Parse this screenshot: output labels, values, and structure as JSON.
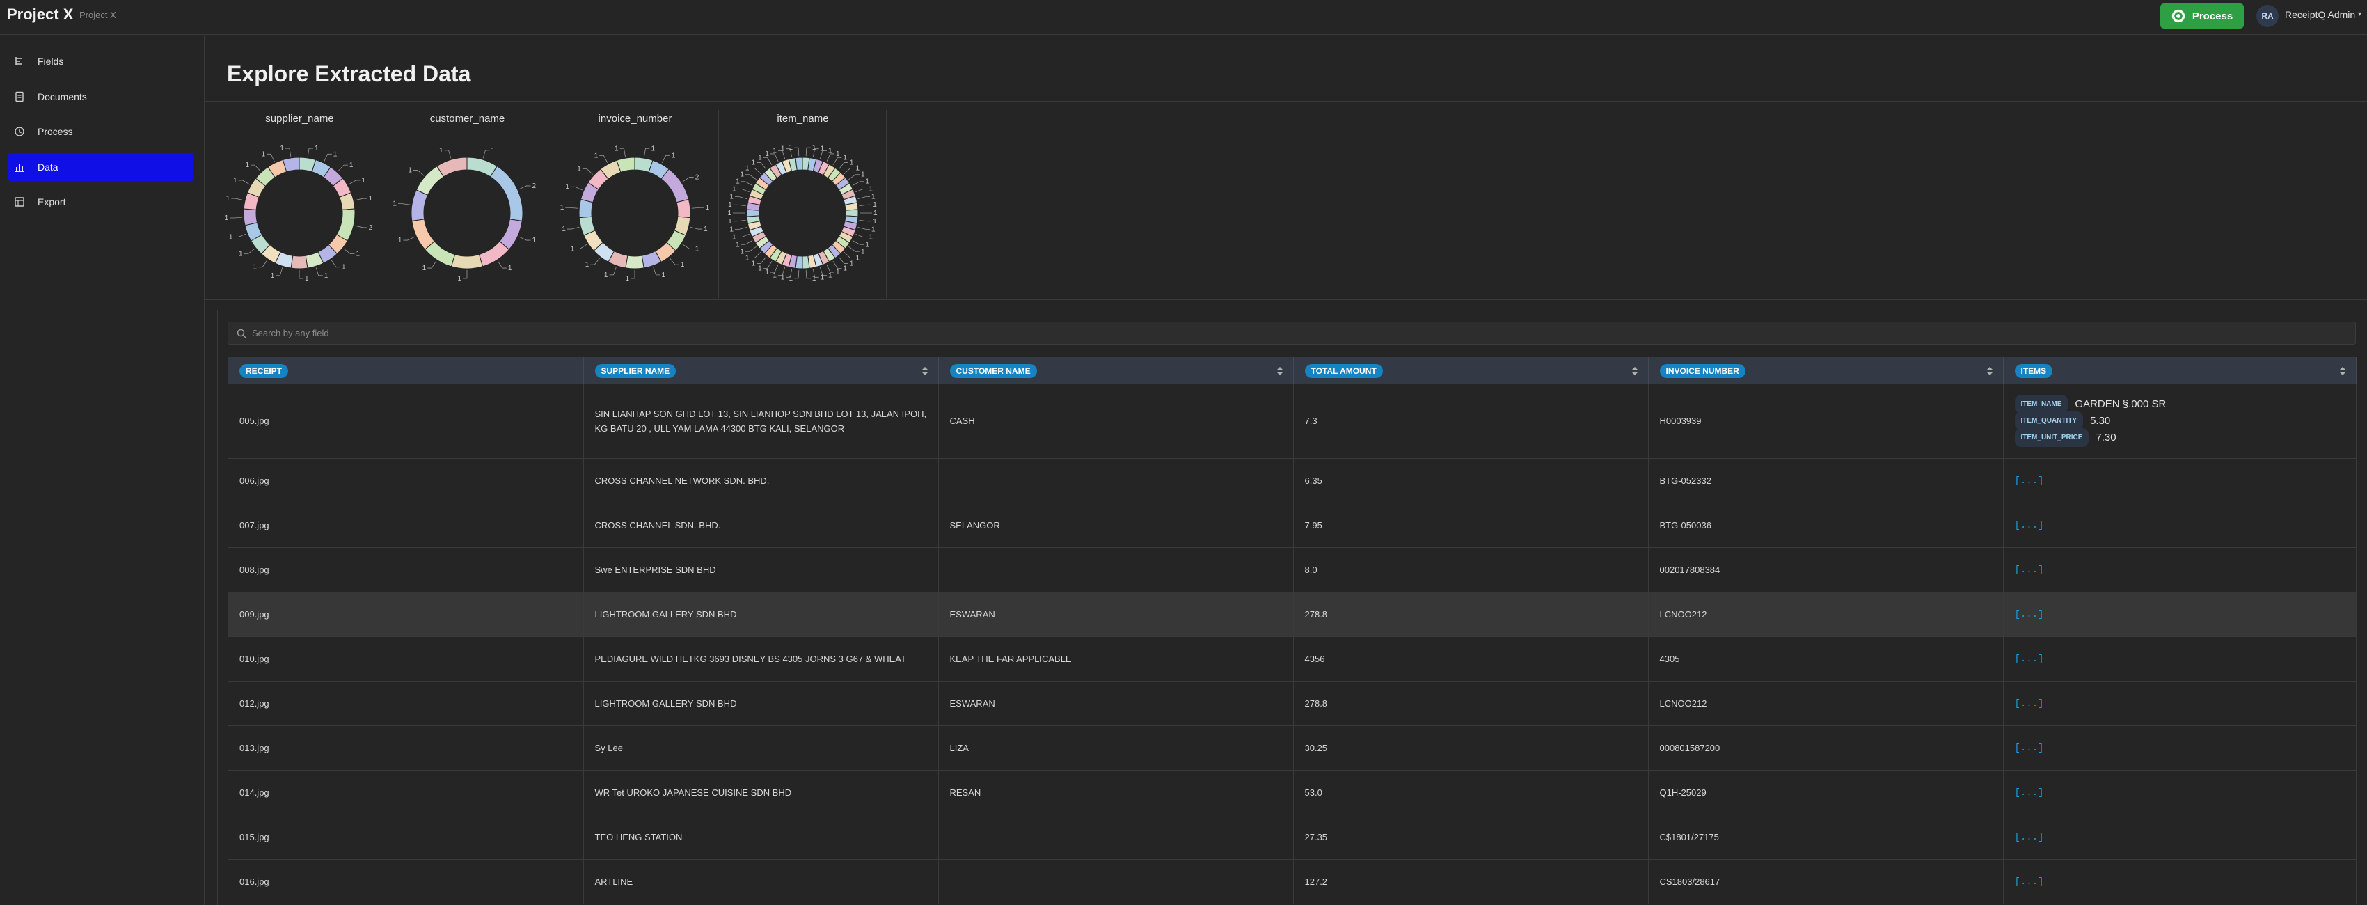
{
  "header": {
    "app_title": "Project X",
    "project_name": "Project X",
    "process_label": "Process",
    "user_initials": "RA",
    "user_name": "ReceiptQ Admin"
  },
  "sidebar": {
    "items": [
      {
        "label": "Fields",
        "icon": "fields-icon",
        "active": false
      },
      {
        "label": "Documents",
        "icon": "document-icon",
        "active": false
      },
      {
        "label": "Process",
        "icon": "process-icon",
        "active": false
      },
      {
        "label": "Data",
        "icon": "bar-chart-icon",
        "active": true
      },
      {
        "label": "Export",
        "icon": "export-icon",
        "active": false
      }
    ]
  },
  "page": {
    "title": "Explore Extracted Data"
  },
  "charts": [
    {
      "title": "supplier_name",
      "segment_values": [
        1,
        1,
        1,
        1,
        1,
        2,
        1,
        1,
        1,
        1,
        1,
        1,
        1,
        1,
        1,
        1,
        1,
        1,
        1,
        1
      ]
    },
    {
      "title": "customer_name",
      "segment_values": [
        1,
        2,
        1,
        1,
        1,
        1,
        1,
        1,
        1,
        1
      ]
    },
    {
      "title": "invoice_number",
      "segment_values": [
        1,
        1,
        2,
        1,
        1,
        1,
        1,
        1,
        1,
        1,
        1,
        1,
        1,
        1,
        1,
        1,
        1,
        1
      ]
    },
    {
      "title": "item_name",
      "segment_values": [
        1,
        1,
        1,
        1,
        1,
        1,
        1,
        1,
        1,
        1,
        1,
        1,
        1,
        1,
        1,
        1,
        1,
        1,
        1,
        1,
        1,
        1,
        1,
        1,
        1,
        1,
        1,
        1,
        1,
        1,
        1,
        1,
        1,
        1,
        1,
        1,
        1,
        1,
        1,
        1,
        1,
        1,
        1,
        1,
        1,
        1,
        1,
        1,
        1,
        1
      ]
    }
  ],
  "chart_colors": [
    "#b9ded0",
    "#a9c8e8",
    "#c4a9dd",
    "#f2b8c6",
    "#e8d9b5",
    "#c9e4b7",
    "#f5c9a9",
    "#b4b4e6",
    "#d6e9c6",
    "#e6b8b8",
    "#cfe0f0",
    "#f0e0c0"
  ],
  "search": {
    "placeholder": "Search by any field"
  },
  "table": {
    "columns": [
      {
        "label": "RECEIPT",
        "sortable": false
      },
      {
        "label": "SUPPLIER NAME",
        "sortable": true
      },
      {
        "label": "CUSTOMER NAME",
        "sortable": true
      },
      {
        "label": "TOTAL AMOUNT",
        "sortable": true
      },
      {
        "label": "INVOICE NUMBER",
        "sortable": true
      },
      {
        "label": "ITEMS",
        "sortable": true
      }
    ],
    "rows": [
      {
        "receipt": "005.jpg",
        "supplier": "SIN LIANHAP SON GHD LOT 13, SIN LIANHOP SDN BHD LOT 13, JALAN IPOH, KG BATU 20 , ULL YAM LAMA 44300 BTG KALI, SELANGOR",
        "customer": "CASH",
        "total": "7.3",
        "invoice": "H0003939",
        "items": [
          {
            "key": "ITEM_NAME",
            "value": "GARDEN §.000 SR"
          },
          {
            "key": "ITEM_QUANTITY",
            "value": "5.30"
          },
          {
            "key": "ITEM_UNIT_PRICE",
            "value": "7.30"
          }
        ]
      },
      {
        "receipt": "006.jpg",
        "supplier": "CROSS CHANNEL NETWORK SDN. BHD.",
        "customer": "",
        "total": "6.35",
        "invoice": "BTG-052332",
        "items_text": "[...]"
      },
      {
        "receipt": "007.jpg",
        "supplier": "CROSS CHANNEL SDN. BHD.",
        "customer": "SELANGOR",
        "total": "7.95",
        "invoice": "BTG-050036",
        "items_text": "[...]"
      },
      {
        "receipt": "008.jpg",
        "supplier": "Swe ENTERPRISE SDN BHD",
        "customer": "",
        "total": "8.0",
        "invoice": "002017808384",
        "items_text": "[...]"
      },
      {
        "receipt": "009.jpg",
        "supplier": "LIGHTROOM GALLERY SDN BHD",
        "customer": "ESWARAN",
        "total": "278.8",
        "invoice": "LCNOO212",
        "items_text": "[...]",
        "highlight": true
      },
      {
        "receipt": "010.jpg",
        "supplier": "PEDIAGURE WILD HETKG 3693 DISNEY BS 4305 JORNS 3 G67 & WHEAT",
        "customer": "KEAP THE FAR APPLICABLE",
        "total": "4356",
        "invoice": "4305",
        "items_text": "[...]"
      },
      {
        "receipt": "012.jpg",
        "supplier": "LIGHTROOM GALLERY SDN BHD",
        "customer": "ESWARAN",
        "total": "278.8",
        "invoice": "LCNOO212",
        "items_text": "[...]"
      },
      {
        "receipt": "013.jpg",
        "supplier": "Sy Lee",
        "customer": "LIZA",
        "total": "30.25",
        "invoice": "000801587200",
        "items_text": "[...]"
      },
      {
        "receipt": "014.jpg",
        "supplier": "WR Tet UROKO JAPANESE CUISINE SDN BHD",
        "customer": "RESAN",
        "total": "53.0",
        "invoice": "Q1H-25029",
        "items_text": "[...]"
      },
      {
        "receipt": "015.jpg",
        "supplier": "TEO HENG STATION",
        "customer": "",
        "total": "27.35",
        "invoice": "C$1801/27175",
        "items_text": "[...]"
      },
      {
        "receipt": "016.jpg",
        "supplier": "ARTLINE",
        "customer": "",
        "total": "127.2",
        "invoice": "CS1803/28617",
        "items_text": "[...]"
      }
    ]
  }
}
